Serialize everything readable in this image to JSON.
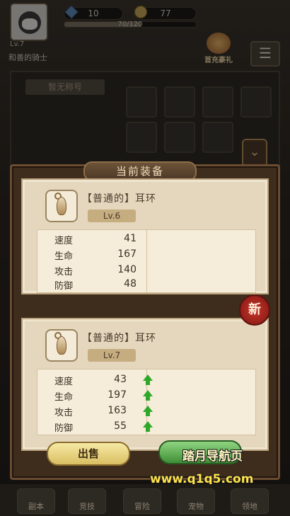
{
  "player": {
    "level_label": "Lv.7",
    "name": "和善的骑士",
    "gems": "10",
    "coins": "77",
    "exp_text": "70/120",
    "exp_fraction": 0.583
  },
  "recharge_label": "首充豪礼",
  "title_badge": "暂无称号",
  "modal": {
    "title": "当前装备",
    "current": {
      "name": "【普通的】耳环",
      "level": "Lv.6",
      "stats": [
        {
          "name": "速度",
          "value": "41"
        },
        {
          "name": "生命",
          "value": "167"
        },
        {
          "name": "攻击",
          "value": "140"
        },
        {
          "name": "防御",
          "value": "48"
        }
      ]
    },
    "new_item": {
      "badge": "新",
      "name": "【普通的】耳环",
      "level": "Lv.7",
      "stats": [
        {
          "name": "速度",
          "value": "43",
          "up": true
        },
        {
          "name": "生命",
          "value": "197",
          "up": true
        },
        {
          "name": "攻击",
          "value": "163",
          "up": true
        },
        {
          "name": "防御",
          "value": "55",
          "up": true
        }
      ]
    },
    "sell_label": "出售"
  },
  "watermark": {
    "line1": "踏月导航页",
    "line2": "www.q1q5.com"
  },
  "nav": [
    {
      "label": "副本"
    },
    {
      "label": "竞技"
    },
    {
      "label": "冒险"
    },
    {
      "label": "宠物"
    },
    {
      "label": "领地"
    }
  ],
  "colors": {
    "card_bg": "#e4d7bd",
    "stat_up_arrow": "#2fa82a",
    "seal_red": "#c8352a",
    "sell_button": "#f7e9a4",
    "equip_button": "#3f8f36"
  }
}
